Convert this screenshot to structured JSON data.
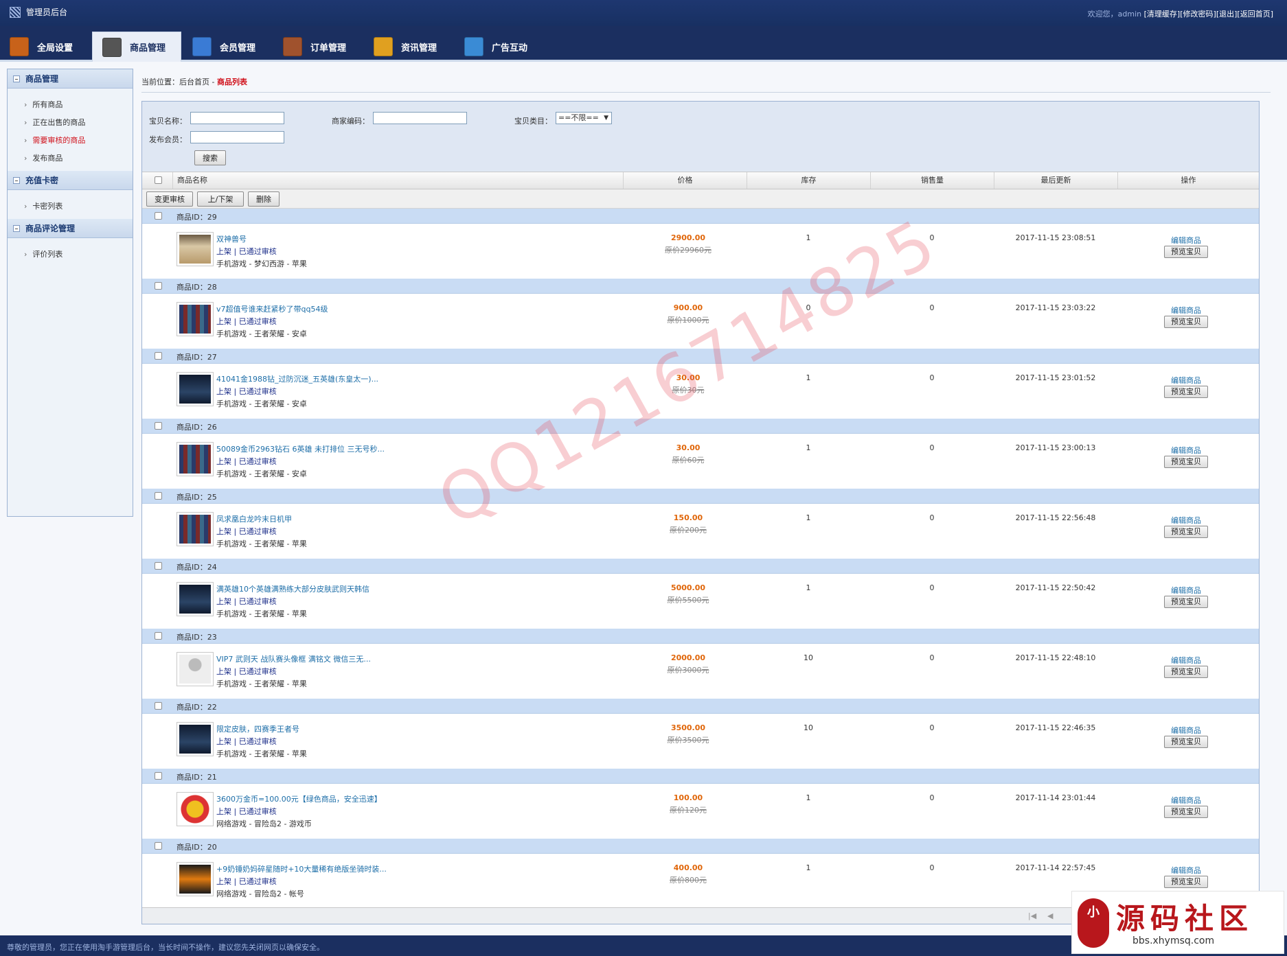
{
  "topbar": {
    "title": "管理员后台",
    "welcome": "欢迎您，admin",
    "links": [
      "[清理缓存]",
      "[修改密码]",
      "[退出]",
      "[返回首页]"
    ]
  },
  "nav": {
    "tabs": [
      {
        "label": "全局设置",
        "icon": "settings-box-icon",
        "color": "#c8621a"
      },
      {
        "label": "商品管理",
        "icon": "grid-window-icon",
        "color": "#555555",
        "active": true
      },
      {
        "label": "会员管理",
        "icon": "member-card-icon",
        "color": "#3a7bd5"
      },
      {
        "label": "订单管理",
        "icon": "wallet-icon",
        "color": "#a0522d"
      },
      {
        "label": "资讯管理",
        "icon": "folder-bookmark-icon",
        "color": "#e0a020"
      },
      {
        "label": "广告互动",
        "icon": "list-window-icon",
        "color": "#3a8bd5"
      }
    ]
  },
  "sidebar": {
    "sections": [
      {
        "title": "商品管理",
        "items": [
          "所有商品",
          "正在出售的商品",
          "需要审核的商品",
          "发布商品"
        ],
        "highlight": 2
      },
      {
        "title": "充值卡密",
        "items": [
          "卡密列表"
        ]
      },
      {
        "title": "商品评论管理",
        "items": [
          "评价列表"
        ]
      }
    ]
  },
  "breadcrumb": {
    "prefix": "当前位置：",
    "home": "后台首页",
    "sep": " - ",
    "current": "商品列表"
  },
  "filter": {
    "name_label": "宝贝名称：",
    "code_label": "商家编码：",
    "category_label": "宝贝类目：",
    "category_value": "==不限==",
    "member_label": "发布会员：",
    "search_label": "搜索"
  },
  "table": {
    "headers": [
      "商品名称",
      "价格",
      "库存",
      "销售量",
      "最后更新",
      "操作"
    ],
    "actions": [
      "变更审核",
      "上/下架",
      "删除"
    ],
    "id_prefix": "商品ID：",
    "edit_label": "编辑商品",
    "preview_label": "预览宝贝",
    "rows": [
      {
        "id": "29",
        "name": "双神兽号",
        "status": "上架 | 已通过审核",
        "category": "手机游戏 - 梦幻西游 - 苹果",
        "price": "2900.00",
        "original": "原价29960元",
        "stock": "1",
        "sales": "0",
        "updated": "2017-11-15 23:08:51",
        "thumb": "game-screenshot-beige"
      },
      {
        "id": "28",
        "name": "v7超值号谁来赶紧秒了带qq54级",
        "status": "上架 | 已通过审核",
        "category": "手机游戏 - 王者荣耀 - 安卓",
        "price": "900.00",
        "original": "原价1000元",
        "stock": "0",
        "sales": "0",
        "updated": "2017-11-15 23:03:22",
        "thumb": "hero-grid"
      },
      {
        "id": "27",
        "name": "41041金1988钻_过防沉迷_五英雄(东皇太一)...",
        "status": "上架 | 已通过审核",
        "category": "手机游戏 - 王者荣耀 - 安卓",
        "price": "30.00",
        "original": "原价30元",
        "stock": "1",
        "sales": "0",
        "updated": "2017-11-15 23:01:52",
        "thumb": "dark-screen"
      },
      {
        "id": "26",
        "name": "50089金币2963钻石 6英雄 未打排位 三无号秒...",
        "status": "上架 | 已通过审核",
        "category": "手机游戏 - 王者荣耀 - 安卓",
        "price": "30.00",
        "original": "原价60元",
        "stock": "1",
        "sales": "0",
        "updated": "2017-11-15 23:00:13",
        "thumb": "hero-grid"
      },
      {
        "id": "25",
        "name": "凤求凰白龙吟末日机甲",
        "status": "上架 | 已通过审核",
        "category": "手机游戏 - 王者荣耀 - 苹果",
        "price": "150.00",
        "original": "原价200元",
        "stock": "1",
        "sales": "0",
        "updated": "2017-11-15 22:56:48",
        "thumb": "hero-grid"
      },
      {
        "id": "24",
        "name": "满英雄10个英雄满熟练大部分皮肤武则天韩信",
        "status": "上架 | 已通过审核",
        "category": "手机游戏 - 王者荣耀 - 苹果",
        "price": "5000.00",
        "original": "原价5500元",
        "stock": "1",
        "sales": "0",
        "updated": "2017-11-15 22:50:42",
        "thumb": "dark-screen"
      },
      {
        "id": "23",
        "name": "VIP7 武则天 战队赛头像框 满铭文 微信三无...",
        "status": "上架 | 已通过审核",
        "category": "手机游戏 - 王者荣耀 - 苹果",
        "price": "2000.00",
        "original": "原价3000元",
        "stock": "10",
        "sales": "0",
        "updated": "2017-11-15 22:48:10",
        "thumb": "placeholder-logo"
      },
      {
        "id": "22",
        "name": "限定皮肤，四赛季王者号",
        "status": "上架 | 已通过审核",
        "category": "手机游戏 - 王者荣耀 - 苹果",
        "price": "3500.00",
        "original": "原价3500元",
        "stock": "10",
        "sales": "0",
        "updated": "2017-11-15 22:46:35",
        "thumb": "dark-screen"
      },
      {
        "id": "21",
        "name": "3600万金币=100.00元【绿色商品，安全迅速】",
        "status": "上架 | 已通过审核",
        "category": "网络游戏 - 冒险岛2 - 游戏币",
        "price": "100.00",
        "original": "原价120元",
        "stock": "1",
        "sales": "0",
        "updated": "2017-11-14 23:01:44",
        "thumb": "maple-logo"
      },
      {
        "id": "20",
        "name": "+9奶锤奶妈碎星随时+10大量稀有绝版坐骑时装...",
        "status": "上架 | 已通过审核",
        "category": "网络游戏 - 冒险岛2 - 帐号",
        "price": "400.00",
        "original": "原价800元",
        "stock": "1",
        "sales": "0",
        "updated": "2017-11-14 22:57:45",
        "thumb": "game-screenshot-orange"
      }
    ]
  },
  "footer": {
    "notice": "尊敬的管理员，您正在使用淘手游管理后台，当长时间不操作，建议您先关闭网页以确保安全。"
  },
  "watermark": {
    "text": "QQ1216714825"
  },
  "logo": {
    "seal": "小",
    "title": "源码社区",
    "url": "bbs.xhymsq.com"
  },
  "colors": {
    "nav_bg": "#1b2f60",
    "row_head": "#c9dcf4",
    "price": "#e0660a",
    "link": "#1d6ea8",
    "highlight": "#d0101a"
  }
}
